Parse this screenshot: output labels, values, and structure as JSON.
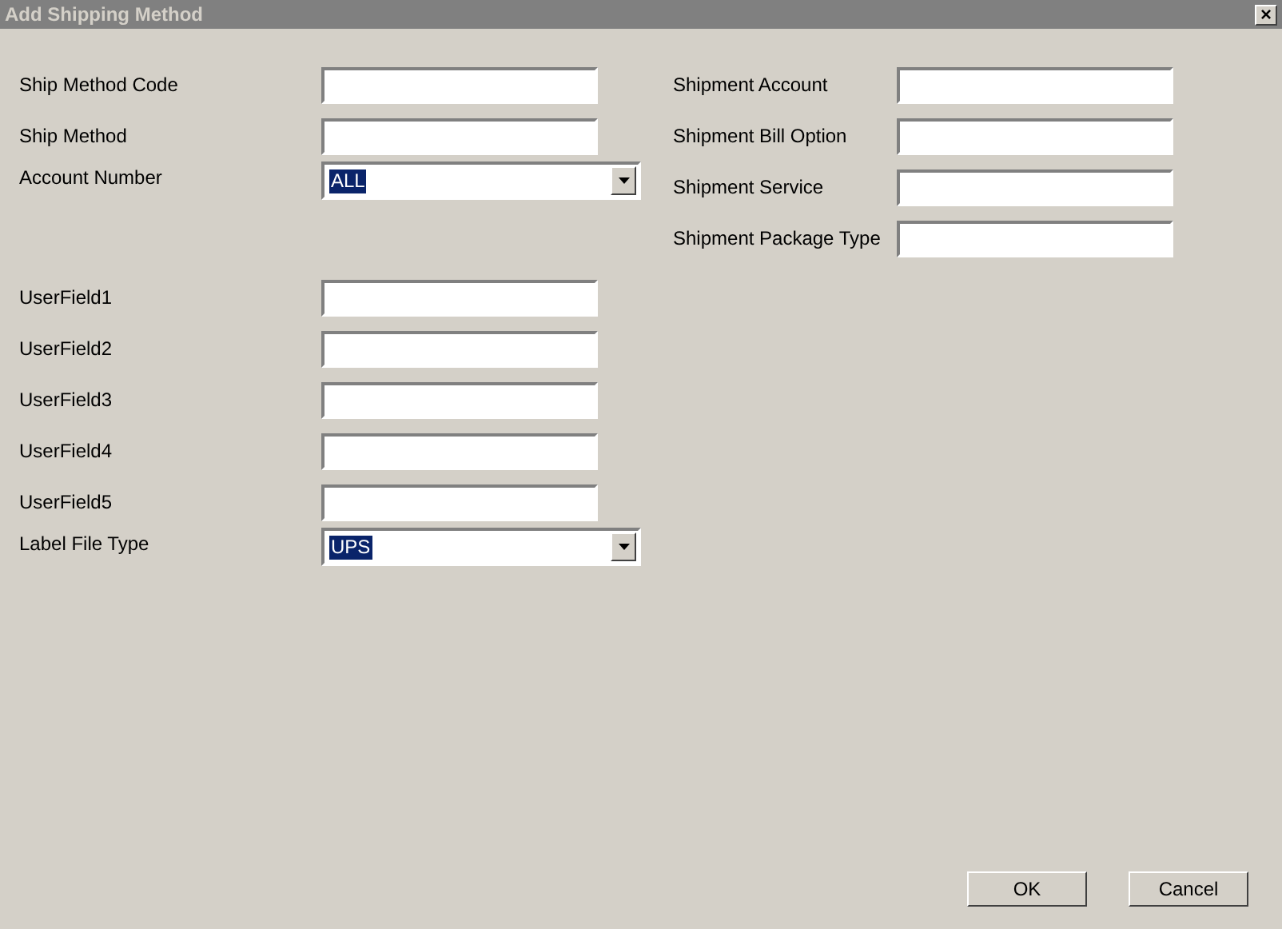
{
  "window": {
    "title": "Add Shipping Method",
    "close": "×"
  },
  "left_sections": [
    [
      {
        "label": "Ship Method Code",
        "kind": "text"
      },
      {
        "label": "Ship Method",
        "kind": "text"
      },
      {
        "label": "Account Number",
        "kind": "select",
        "value": "ALL"
      }
    ],
    [
      {
        "label": "UserField1",
        "kind": "text"
      },
      {
        "label": "UserField2",
        "kind": "text"
      },
      {
        "label": "UserField3",
        "kind": "text"
      },
      {
        "label": "UserField4",
        "kind": "text"
      },
      {
        "label": "UserField5",
        "kind": "text"
      },
      {
        "label": "Label File Type",
        "kind": "select",
        "value": "UPS"
      }
    ]
  ],
  "right_fields": [
    {
      "label": "Shipment Account",
      "kind": "text"
    },
    {
      "label": "Shipment Bill Option",
      "kind": "text"
    },
    {
      "label": "Shipment Service",
      "kind": "text"
    },
    {
      "label": "Shipment Package Type",
      "kind": "text"
    }
  ],
  "buttons": [
    "OK",
    "Cancel"
  ]
}
